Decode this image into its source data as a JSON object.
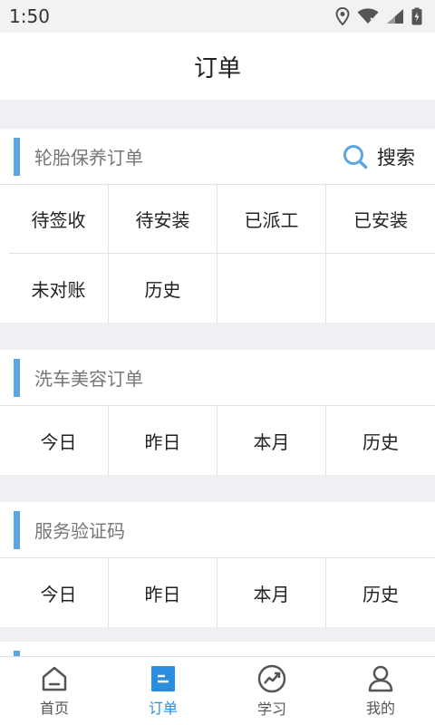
{
  "status_bar": {
    "time": "1:50"
  },
  "header": {
    "title": "订单"
  },
  "sections": [
    {
      "title": "轮胎保养订单",
      "search_label": "搜索",
      "items": [
        "待签收",
        "待安装",
        "已派工",
        "已安装",
        "未对账",
        "历史",
        "",
        ""
      ]
    },
    {
      "title": "洗车美容订单",
      "items": [
        "今日",
        "昨日",
        "本月",
        "历史"
      ]
    },
    {
      "title": "服务验证码",
      "items": [
        "今日",
        "昨日",
        "本月",
        "历史"
      ]
    }
  ],
  "tabbar": {
    "items": [
      {
        "label": "首页",
        "icon": "home-icon"
      },
      {
        "label": "订单",
        "icon": "order-icon",
        "active": true
      },
      {
        "label": "学习",
        "icon": "learn-icon"
      },
      {
        "label": "我的",
        "icon": "profile-icon"
      }
    ]
  },
  "colors": {
    "accent": "#2a8de0",
    "section_bar": "#5aa6e3",
    "background": "#efeff4"
  }
}
